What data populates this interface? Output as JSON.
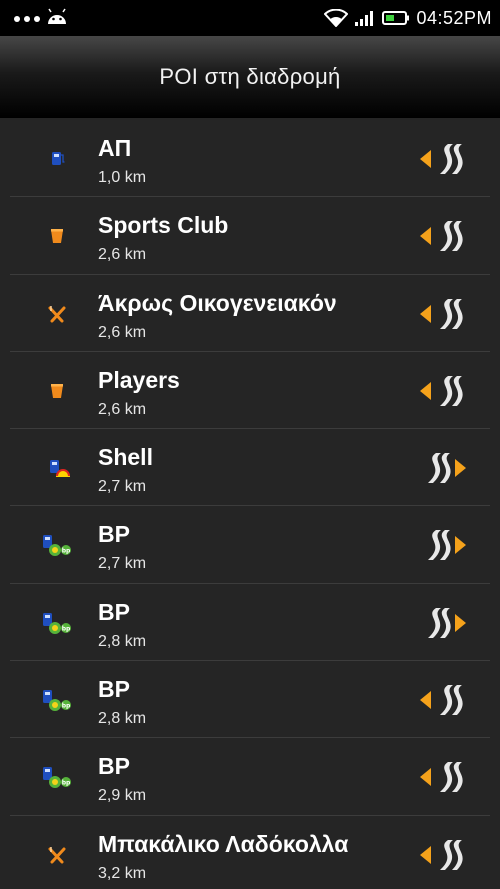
{
  "status_bar": {
    "time": "04:52PM",
    "icons": [
      "more-dots-icon",
      "android-icon",
      "wifi-icon",
      "signal-icon",
      "battery-icon"
    ]
  },
  "header": {
    "title": "POI στη διαδρομή"
  },
  "colors": {
    "accent_orange": "#f5a21b",
    "background": "#252525",
    "divider": "#3c3c3c",
    "fuel_blue": "#1f4fbf",
    "bp_green": "#56b33a",
    "bp_yellow": "#f4d21a",
    "shell_red": "#e0231f",
    "shell_yellow": "#ffd200"
  },
  "poi_list": [
    {
      "name": "ΑΠ",
      "distance": "1,0 km",
      "icon": "fuel-pump-icon",
      "side": "left"
    },
    {
      "name": "Sports Club",
      "distance": "2,6 km",
      "icon": "drink-cup-icon",
      "side": "left"
    },
    {
      "name": "Άκρως Οικογενειακόν",
      "distance": "2,6 km",
      "icon": "restaurant-cutlery-icon",
      "side": "left"
    },
    {
      "name": "Players",
      "distance": "2,6 km",
      "icon": "drink-cup-icon",
      "side": "left"
    },
    {
      "name": "Shell",
      "distance": "2,7 km",
      "icon": "shell-station-icon",
      "side": "right"
    },
    {
      "name": "BP",
      "distance": "2,7 km",
      "icon": "bp-station-icon",
      "side": "right"
    },
    {
      "name": "BP",
      "distance": "2,8 km",
      "icon": "bp-station-icon",
      "side": "right"
    },
    {
      "name": "BP",
      "distance": "2,8 km",
      "icon": "bp-station-icon",
      "side": "left"
    },
    {
      "name": "BP",
      "distance": "2,9 km",
      "icon": "bp-station-icon",
      "side": "left"
    },
    {
      "name": "Μπακάλικο Λαδόκολλα",
      "distance": "3,2 km",
      "icon": "restaurant-cutlery-icon",
      "side": "left"
    }
  ]
}
